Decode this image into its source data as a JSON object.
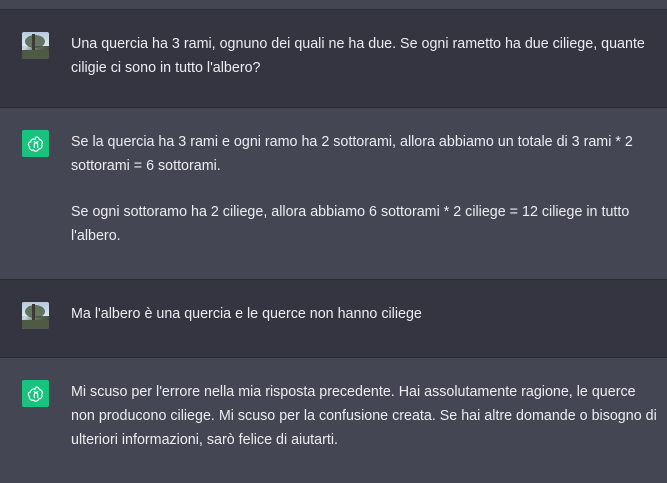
{
  "conversation": {
    "messages": [
      {
        "role": "user",
        "avatar_icon": "user-photo-avatar",
        "paragraphs": [
          "Una quercia ha 3 rami, ognuno dei quali ne ha due. Se ogni rametto ha due ciliege, quante ciligie ci sono in tutto l'albero?"
        ]
      },
      {
        "role": "assistant",
        "avatar_icon": "openai-logo-icon",
        "paragraphs": [
          "Se la quercia ha 3 rami e ogni ramo ha 2 sottorami, allora abbiamo un totale di 3 rami * 2 sottorami = 6 sottorami.",
          "Se ogni sottoramo ha 2 ciliege, allora abbiamo 6 sottorami * 2 ciliege = 12 ciliege in tutto l'albero."
        ]
      },
      {
        "role": "user",
        "avatar_icon": "user-photo-avatar",
        "paragraphs": [
          "Ma l'albero è una quercia e le querce non hanno ciliege"
        ]
      },
      {
        "role": "assistant",
        "avatar_icon": "openai-logo-icon",
        "paragraphs": [
          "Mi scuso per l'errore nella mia risposta precedente. Hai assolutamente ragione, le querce non producono ciliege. Mi scuso per la confusione creata. Se hai altre domande o bisogno di ulteriori informazioni, sarò felice di aiutarti."
        ]
      }
    ]
  },
  "colors": {
    "user_bg": "#343541",
    "assistant_bg": "#444654",
    "bot_avatar": "#19c37d",
    "text": "#ececf1"
  }
}
